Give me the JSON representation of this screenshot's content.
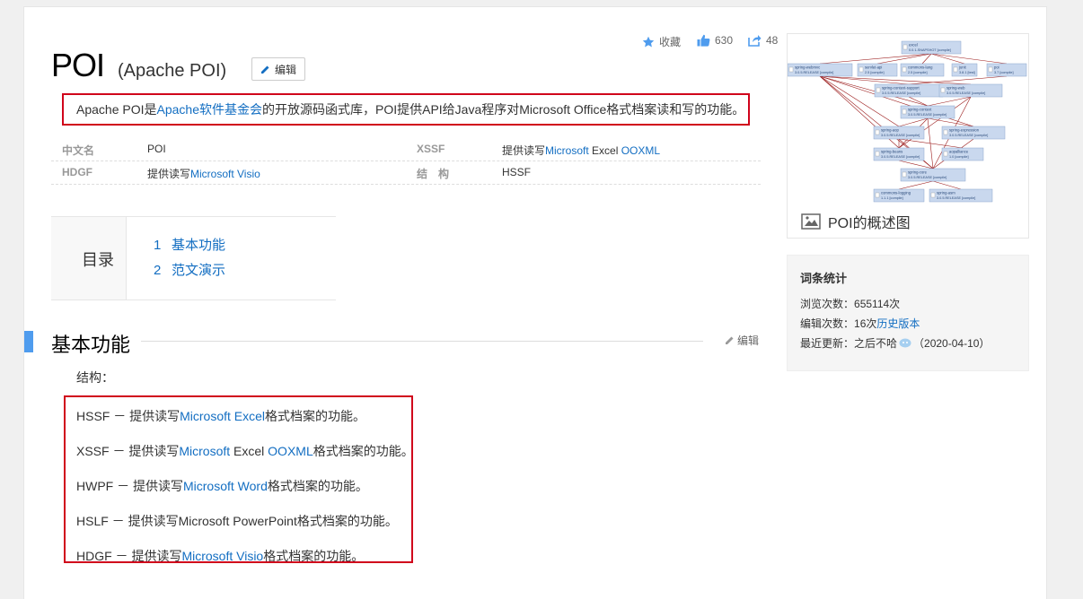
{
  "header": {
    "title": "POI",
    "subtitle": "(Apache POI)",
    "edit_label": "编辑",
    "collect_label": "收藏",
    "like_count": "630",
    "share_count": "48"
  },
  "summary": {
    "part1": "Apache POI是",
    "link": "Apache软件基金会",
    "part2": "的开放源码函式库，POI提供API给Java程序对Microsoft Office格式档案读和写的功能。"
  },
  "basic_info": {
    "r1_k1": "中文名",
    "r1_v1": "POI",
    "r1_k2": "XSSF",
    "r1_v2_pre": "提供读写",
    "r1_v2_link1": "Microsoft",
    "r1_v2_mid": " Excel ",
    "r1_v2_link2": "OOXML",
    "r2_k1": "HDGF",
    "r2_v1_pre": "提供读写",
    "r2_v1_link": "Microsoft Visio",
    "r2_k2": "结　构",
    "r2_v2": "HSSF"
  },
  "toc": {
    "label": "目录",
    "items": [
      {
        "num": "1",
        "label": "基本功能"
      },
      {
        "num": "2",
        "label": "范文演示"
      }
    ]
  },
  "section": {
    "title": "基本功能",
    "edit_label": "编辑",
    "intro": "结构："
  },
  "structure": {
    "i1_pre": "HSSF － 提供读写",
    "i1_link": "Microsoft Excel",
    "i1_post": "格式档案的功能。",
    "i2_pre": "XSSF － 提供读写",
    "i2_link1": "Microsoft",
    "i2_mid": " Excel ",
    "i2_link2": "OOXML",
    "i2_post": "格式档案的功能。",
    "i3_pre": "HWPF － 提供读写",
    "i3_link": "Microsoft Word",
    "i3_post": "格式档案的功能。",
    "i4_text": "HSLF － 提供读写Microsoft PowerPoint格式档案的功能。",
    "i5_pre": "HDGF － 提供读写",
    "i5_link": "Microsoft Visio",
    "i5_post": "格式档案的功能。"
  },
  "diagram": {
    "caption": "POI的概述图",
    "nodes": [
      {
        "name": "excel",
        "ver": "0.0.1-SNAPSHOT [compile]"
      },
      {
        "name": "spring-webmvc",
        "ver": "3.0.5.RELEASE [compile]"
      },
      {
        "name": "servlet-api",
        "ver": "2.5 [compile]"
      },
      {
        "name": "commons-lang",
        "ver": "2.5 [compile]"
      },
      {
        "name": "junit",
        "ver": "3.8.1 [test]"
      },
      {
        "name": "poi",
        "ver": "3.7 [compile]"
      },
      {
        "name": "spring-context-support",
        "ver": "3.0.5.RELEASE [compile]"
      },
      {
        "name": "spring-web",
        "ver": "3.0.5.RELEASE [compile]"
      },
      {
        "name": "spring-context",
        "ver": "3.0.5.RELEASE [compile]"
      },
      {
        "name": "spring-aop",
        "ver": "3.0.5.RELEASE [compile]"
      },
      {
        "name": "spring-expression",
        "ver": "3.0.5.RELEASE [compile]"
      },
      {
        "name": "spring-beans",
        "ver": "3.0.5.RELEASE [compile]"
      },
      {
        "name": "aopalliance",
        "ver": "1.0 [compile]"
      },
      {
        "name": "spring-core",
        "ver": "3.0.5.RELEASE [compile]"
      },
      {
        "name": "commons-logging",
        "ver": "1.1.1 [compile]"
      },
      {
        "name": "spring-asm",
        "ver": "3.0.5.RELEASE [compile]"
      }
    ]
  },
  "stats": {
    "title": "词条统计",
    "views_label": "浏览次数：",
    "views": "655114次",
    "edits_label": "编辑次数：",
    "edits": "16次",
    "history_link": "历史版本",
    "updated_label": "最近更新：",
    "updated_user": "之后不哈",
    "updated_date": "（2020-04-10）"
  },
  "colors": {
    "link": "#136ec2",
    "highlight_border": "#d0021b",
    "section_bar": "#4f9cee"
  }
}
